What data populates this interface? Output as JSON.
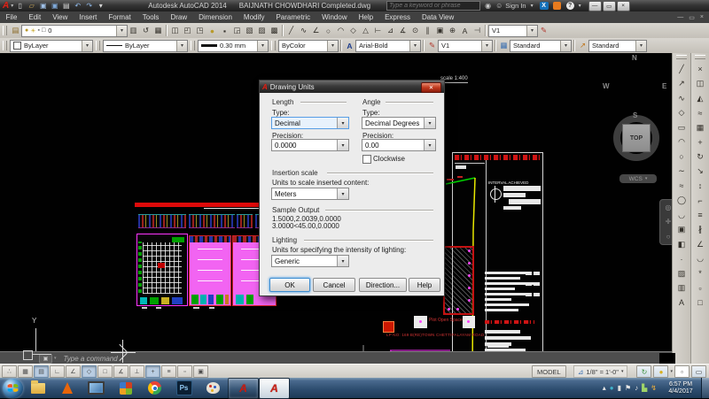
{
  "titlebar": {
    "app_title": "Autodesk AutoCAD 2014",
    "doc_title": "BAIJNATH CHOWDHARI Completed.dwg",
    "search_placeholder": "Type a keyword or phrase",
    "sign_in": "Sign In",
    "help_glyph": "?",
    "exchange_glyph": "X"
  },
  "menubar": {
    "items": [
      "File",
      "Edit",
      "View",
      "Insert",
      "Format",
      "Tools",
      "Draw",
      "Dimension",
      "Modify",
      "Parametric",
      "Window",
      "Help",
      "Express",
      "Data View"
    ]
  },
  "toolbars": {
    "layer_combo": "0",
    "color_combo": "ByLayer",
    "linetype_combo": "ByLayer",
    "lineweight_combo": "0.30 mm",
    "plotstyle_combo": "ByColor",
    "textstyle_combo": "Arial-Bold",
    "dimstyle_combo": "V1",
    "dimstyle_combo_top": "V1",
    "tablestyle_combo": "Standard",
    "mleaderstyle_combo": "Standard"
  },
  "dialog": {
    "title": "Drawing Units",
    "length_group": "Length",
    "angle_group": "Angle",
    "type_label": "Type:",
    "angle_type_label": "Type:",
    "precision_label": "Precision:",
    "angle_precision_label": "Precision:",
    "length_type_value": "Decimal",
    "length_precision_value": "0.0000",
    "angle_type_value": "Decimal Degrees",
    "angle_precision_value": "0.00",
    "clockwise_label": "Clockwise",
    "insertion_group": "Insertion scale",
    "insertion_label": "Units to scale inserted content:",
    "insertion_value": "Meters",
    "sample_group": "Sample Output",
    "sample_line1": "1.5000,2.0039,0.0000",
    "sample_line2": "3.0000<45.00,0.0000",
    "lighting_group": "Lighting",
    "lighting_label": "Units for specifying the intensity of lighting:",
    "lighting_value": "Generic",
    "ok_label": "OK",
    "cancel_label": "Cancel",
    "direction_label": "Direction...",
    "help_label": "Help"
  },
  "canvas": {
    "scale_note": "scale 1:400",
    "interval_label": "INTERVAL ACHIEVED",
    "plot_label": "Plot Open Space",
    "road_label": "LP NO: 169 B(RE)TOWN CHETTIPALAYAM ROAD",
    "ucs_y_label": "Y",
    "viewcube": {
      "n": "N",
      "w": "W",
      "e": "E",
      "s": "S",
      "top": "TOP",
      "wcs": "WCS"
    }
  },
  "commandline": {
    "prompt": "Type a command"
  },
  "statusbar": {
    "model_label": "MODEL",
    "annotation_scale": "1/8\" = 1'-0\""
  },
  "taskbar": {
    "time": "6:57 PM",
    "date": "4/4/2017",
    "ps_label": "Ps",
    "acad_letter": "A"
  },
  "strips": {
    "qat": [
      {
        "name": "new-file-icon",
        "g": "▯"
      },
      {
        "name": "open-file-icon",
        "g": "▱",
        "color": "#d8b35c"
      },
      {
        "name": "save-icon",
        "g": "▣",
        "color": "#9fc0e8"
      },
      {
        "name": "saveas-icon",
        "g": "▣",
        "color": "#7fa8d8"
      },
      {
        "name": "plot-icon",
        "g": "▤"
      },
      {
        "name": "undo-icon",
        "g": "↶",
        "color": "#8fb8e8"
      },
      {
        "name": "redo-icon",
        "g": "↷",
        "color": "#8fb8e8"
      },
      {
        "name": "qat-menu-icon",
        "g": "▾"
      }
    ],
    "layer_tools_left": [
      {
        "name": "layer-properties-icon",
        "g": "▤",
        "color": "#8a6a28"
      }
    ],
    "layer_tools_right": [
      {
        "name": "make-layer-current-icon",
        "g": "▥"
      },
      {
        "name": "layer-previous-icon",
        "g": "↺"
      },
      {
        "name": "layer-states-icon",
        "g": "▦"
      }
    ],
    "layer_tools2": [
      {
        "name": "layer-isolate-icon",
        "g": "◫"
      },
      {
        "name": "layer-unisolate-icon",
        "g": "◰"
      },
      {
        "name": "layer-freeze-icon",
        "g": "◳"
      },
      {
        "name": "layer-off-icon",
        "g": "●",
        "color": "#b89a2a"
      },
      {
        "name": "layer-lock-icon",
        "g": "▪"
      },
      {
        "name": "layer-walk-icon",
        "g": "◲"
      },
      {
        "name": "layer-match-icon",
        "g": "▧"
      },
      {
        "name": "copy-to-layer-icon",
        "g": "▨"
      },
      {
        "name": "layer-merge-icon",
        "g": "▩"
      }
    ],
    "row1_right": [
      {
        "name": "measure-tool-icon",
        "g": "╱"
      },
      {
        "name": "polyline-edit-icon",
        "g": "∿"
      },
      {
        "name": "angle-tool-icon",
        "g": "∠"
      },
      {
        "name": "circle-tool-icon",
        "g": "○"
      },
      {
        "name": "arc-tool-icon",
        "g": "◠"
      },
      {
        "name": "polygon-tool-icon",
        "g": "◇"
      },
      {
        "name": "triangle-tool-icon",
        "g": "△"
      },
      {
        "name": "dim-linear-icon",
        "g": "⊢"
      },
      {
        "name": "dim-aligned-icon",
        "g": "⊿"
      },
      {
        "name": "dim-angular-icon",
        "g": "∡"
      },
      {
        "name": "dim-radius-icon",
        "g": "⊙"
      },
      {
        "name": "dim-continue-icon",
        "g": "∥"
      },
      {
        "name": "tolerance-icon",
        "g": "▣"
      },
      {
        "name": "center-mark-icon",
        "g": "⊕"
      },
      {
        "name": "dim-text-edit-icon",
        "g": "A"
      },
      {
        "name": "dim-update-icon",
        "g": "⊣"
      }
    ],
    "row1_tail": [
      {
        "name": "dim-style-edit-icon",
        "g": "✎",
        "color": "#b0342a"
      }
    ],
    "draw_toolbar": [
      {
        "name": "line-tool-icon",
        "g": "╱"
      },
      {
        "name": "construction-line-icon",
        "g": "↗"
      },
      {
        "name": "polyline-tool-icon",
        "g": "∿"
      },
      {
        "name": "polygon-icon",
        "g": "◇"
      },
      {
        "name": "rectangle-tool-icon",
        "g": "▭"
      },
      {
        "name": "arc-icon",
        "g": "◠"
      },
      {
        "name": "circle-icon",
        "g": "○"
      },
      {
        "name": "revision-cloud-icon",
        "g": "∼"
      },
      {
        "name": "spline-icon",
        "g": "≈"
      },
      {
        "name": "ellipse-icon",
        "g": "◯"
      },
      {
        "name": "ellipse-arc-icon",
        "g": "◡"
      },
      {
        "name": "insert-block-icon",
        "g": "▣"
      },
      {
        "name": "make-block-icon",
        "g": "◧"
      },
      {
        "name": "point-icon",
        "g": "·"
      },
      {
        "name": "hatch-icon",
        "g": "▨"
      },
      {
        "name": "gradient-icon",
        "g": "▥"
      },
      {
        "name": "mtext-icon",
        "g": "A"
      }
    ],
    "modify_toolbar": [
      {
        "name": "erase-icon",
        "g": "×"
      },
      {
        "name": "copy-icon",
        "g": "◫"
      },
      {
        "name": "mirror-icon",
        "g": "◭"
      },
      {
        "name": "offset-icon",
        "g": "≈"
      },
      {
        "name": "array-icon",
        "g": "▦"
      },
      {
        "name": "move-icon",
        "g": "+"
      },
      {
        "name": "rotate-icon",
        "g": "↻"
      },
      {
        "name": "scale-icon",
        "g": "↘"
      },
      {
        "name": "stretch-icon",
        "g": "↕"
      },
      {
        "name": "trim-icon",
        "g": "⌐"
      },
      {
        "name": "extend-icon",
        "g": "≡"
      },
      {
        "name": "break-icon",
        "g": "∦"
      },
      {
        "name": "chamfer-icon",
        "g": "∠"
      },
      {
        "name": "fillet-icon",
        "g": "◡"
      },
      {
        "name": "explode-icon",
        "g": "*"
      },
      {
        "name": "join-icon",
        "g": "▫"
      },
      {
        "name": "blend-icon",
        "g": "□"
      }
    ],
    "status_toggles": [
      {
        "name": "infer-constraints-toggle",
        "g": "∴"
      },
      {
        "name": "snap-mode-toggle",
        "g": "▦"
      },
      {
        "name": "grid-display-toggle",
        "g": "▤",
        "pressed": true
      },
      {
        "name": "ortho-mode-toggle",
        "g": "∟"
      },
      {
        "name": "polar-tracking-toggle",
        "g": "∠"
      },
      {
        "name": "object-snap-toggle",
        "g": "◇",
        "pressed": true
      },
      {
        "name": "3d-object-snap-toggle",
        "g": "□"
      },
      {
        "name": "object-snap-tracking-toggle",
        "g": "∡"
      },
      {
        "name": "dynamic-ucs-toggle",
        "g": "⊥"
      },
      {
        "name": "dynamic-input-toggle",
        "g": "+",
        "pressed": true
      },
      {
        "name": "lineweight-display-toggle",
        "g": "≡"
      },
      {
        "name": "transparency-toggle",
        "g": "▫"
      },
      {
        "name": "quick-properties-toggle",
        "g": "▣"
      }
    ],
    "tray": [
      {
        "name": "tray-expand-icon",
        "g": "▴",
        "color": "#e6e6e6"
      },
      {
        "name": "tray-app-icon",
        "g": "●",
        "color": "#3fb0c8"
      },
      {
        "name": "battery-icon",
        "g": "▮",
        "color": "#dcdcdc"
      },
      {
        "name": "action-center-flag-icon",
        "g": "⚑",
        "color": "#e8e8e8"
      },
      {
        "name": "volume-icon",
        "g": "♪",
        "color": "#e8e8e8"
      },
      {
        "name": "network-icon",
        "g": "▙",
        "color": "#9fd468"
      },
      {
        "name": "power-icon",
        "g": "↯",
        "color": "#f2b13c"
      }
    ]
  },
  "icons": {
    "binoculars": "◉",
    "user": "☺",
    "caret": "▾",
    "minimize": "—",
    "restore": "▭",
    "close": "×",
    "mdi-minimize": "—",
    "mdi-restore": "▭",
    "mdi-close": "×",
    "cmd-tool": "▣",
    "annotation": "⊿",
    "annotation-visibility": "↻",
    "annotation-auto": "●",
    "workspace": "▫",
    "clean-screen": "▭",
    "wcs-caret": "▾",
    "nav-wheel": "◎",
    "nav-pan": "✛",
    "nav-zoom": "○",
    "textstyle": "A",
    "dimstyle": "✎",
    "tablestyle": "▦",
    "mleaderstyle": "↗",
    "bulb": "●",
    "sun": "☀",
    "lock": "▪",
    "sq": "□"
  }
}
